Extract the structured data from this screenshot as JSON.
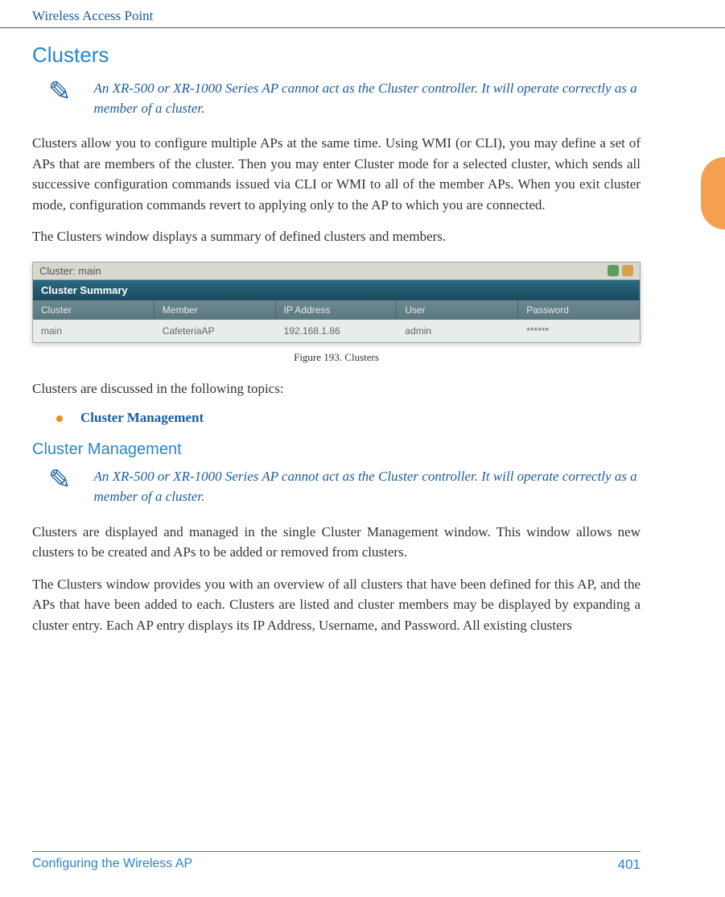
{
  "header": {
    "title": "Wireless Access Point"
  },
  "sections": {
    "clusters": {
      "title": "Clusters",
      "note": "An XR-500 or XR-1000 Series AP cannot act as the Cluster controller. It will operate correctly as a member of a cluster.",
      "para1": "Clusters allow you to configure multiple APs at the same time. Using WMI (or CLI), you may define a set of APs that are members of the cluster. Then you may enter Cluster mode for a selected cluster, which sends all successive configuration commands issued via CLI or WMI to all of the member APs. When you exit cluster mode, configuration commands revert to applying only to the AP to which you are connected.",
      "para2": "The Clusters window displays a summary of defined clusters and members.",
      "para3": "Clusters are discussed in the following topics:",
      "bullet1": "Cluster Management"
    },
    "cluster_mgmt": {
      "title": "Cluster Management",
      "note": "An XR-500 or XR-1000 Series AP cannot act as the Cluster controller. It will operate correctly as a member of a cluster.",
      "para1": "Clusters are displayed and managed in the single Cluster Management window. This window allows new clusters to be created and APs to be added or removed from clusters.",
      "para2": "The Clusters window provides you with an overview of all clusters that have been defined for this AP, and the APs that have been added to each. Clusters are listed and cluster members may be displayed by expanding a cluster entry.   Each AP entry displays its IP Address, Username, and Password. All existing clusters"
    }
  },
  "figure": {
    "topbar_label": "Cluster:  main",
    "summary_label": "Cluster Summary",
    "headers": {
      "cluster": "Cluster",
      "member": "Member",
      "ip": "IP Address",
      "user": "User",
      "password": "Password"
    },
    "row": {
      "cluster": "main",
      "member": "CafeteriaAP",
      "ip": "192.168.1.86",
      "user": "admin",
      "password": "******"
    },
    "caption": "Figure 193. Clusters"
  },
  "footer": {
    "text": "Configuring the Wireless AP",
    "page": "401"
  }
}
